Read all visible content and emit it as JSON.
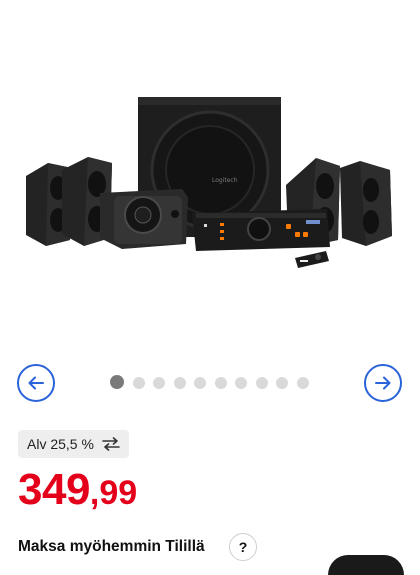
{
  "gallery": {
    "image_alt": "Logitech Z906 5.1 speaker system",
    "brand_logo_text": "Logitech",
    "prev_icon": "arrow-left-icon",
    "next_icon": "arrow-right-icon",
    "dot_count": 10,
    "active_dot": 0
  },
  "vat": {
    "label": "Alv 25,5 %",
    "icon": "swap-arrows-icon"
  },
  "price": {
    "euros": "349",
    "cents": ",99",
    "color": "#e4001b"
  },
  "payment": {
    "label": "Maksa myöhemmin Tilillä",
    "help_label": "?"
  },
  "accent": "#2b63d9"
}
